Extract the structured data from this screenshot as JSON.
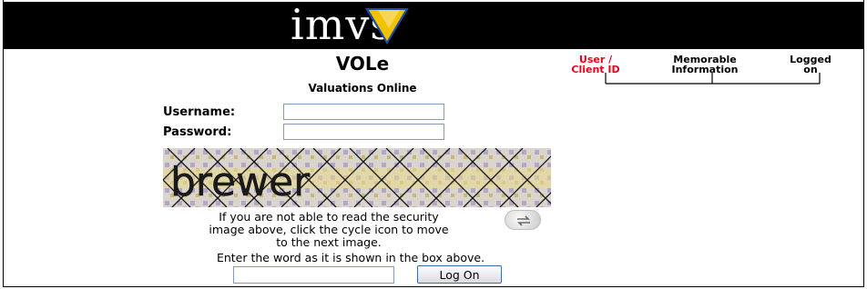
{
  "header": {
    "logo": "imvs"
  },
  "login": {
    "title": "VOLe",
    "subtitle": "Valuations Online",
    "username_label": "Username:",
    "password_label": "Password:",
    "username_value": "",
    "password_value": "",
    "captcha_word": "brewer",
    "help_text_line1": "If you are not able to read the security",
    "help_text_line2": "image above, click the cycle icon to move",
    "help_text_line3": "to the next image.",
    "enter_word_text": "Enter the word as it is shown in the box above.",
    "captcha_input_value": "",
    "logon_button": "Log On"
  },
  "annotations": {
    "user_client_id_line1": "User /",
    "user_client_id_line2": "Client ID",
    "memorable_line1": "Memorable",
    "memorable_line2": "Information",
    "logged_line1": "Logged",
    "logged_line2": "on",
    "accent_color": "#e8001c"
  },
  "icons": {
    "cycle": "refresh-icon"
  }
}
